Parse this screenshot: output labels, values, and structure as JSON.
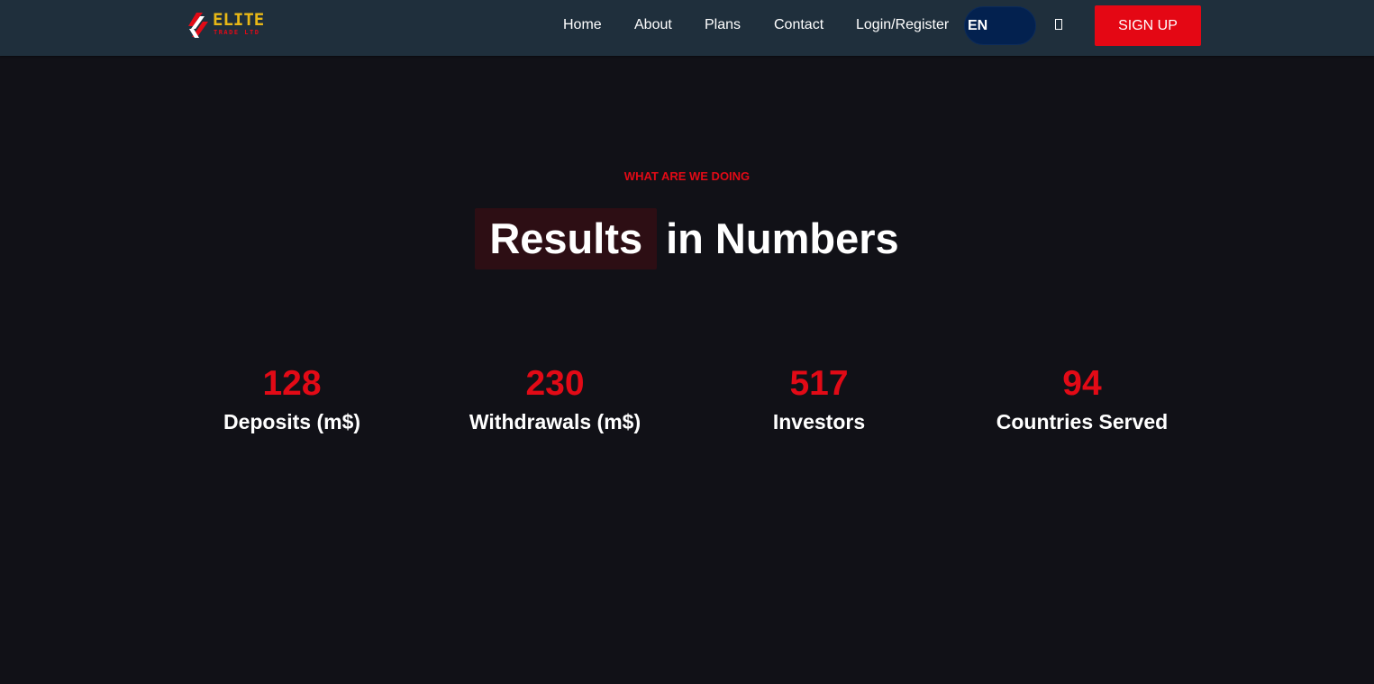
{
  "nav": {
    "logo": {
      "brand": "ELITE",
      "sub": "TRADE LTD"
    },
    "links": [
      "Home",
      "About",
      "Plans",
      "Contact",
      "Login/Register"
    ],
    "language": "EN",
    "signup_label": "SIGN UP"
  },
  "section": {
    "eyebrow": "WHAT ARE WE DOING",
    "title_highlight": "Results",
    "title_rest": "in Numbers"
  },
  "stats": [
    {
      "value": "128",
      "label": "Deposits (m$)"
    },
    {
      "value": "230",
      "label": "Withdrawals (m$)"
    },
    {
      "value": "517",
      "label": "Investors"
    },
    {
      "value": "94",
      "label": "Countries Served"
    }
  ],
  "colors": {
    "accent_red": "#e20a16",
    "logo_gold": "#e8b816",
    "navbar_bg": "#1f2f3c",
    "page_bg": "#111117",
    "lang_bg": "#03214f"
  }
}
